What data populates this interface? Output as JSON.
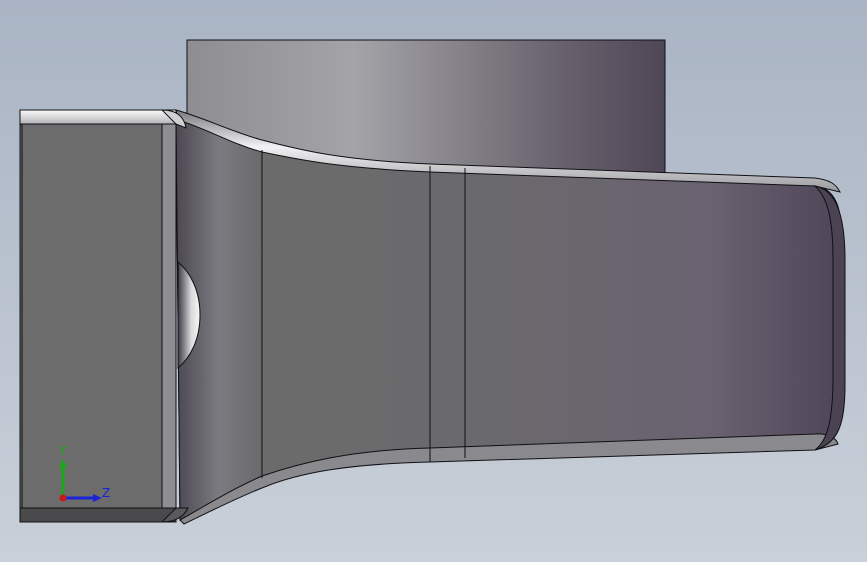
{
  "viewport": {
    "background_top": "#a9b4c4",
    "background_bottom": "#c9d0d9",
    "edge_color": "#101014"
  },
  "model": {
    "colors": {
      "highlight": "#f2f2f4",
      "light": "#b0afb4",
      "mid": "#707071",
      "dark": "#4b4352",
      "darker": "#3a3340"
    }
  },
  "triad": {
    "y_label": "Y",
    "z_label": "Z",
    "y_color": "#18a818",
    "z_color": "#1a24d6",
    "x_color": "#c81818"
  }
}
